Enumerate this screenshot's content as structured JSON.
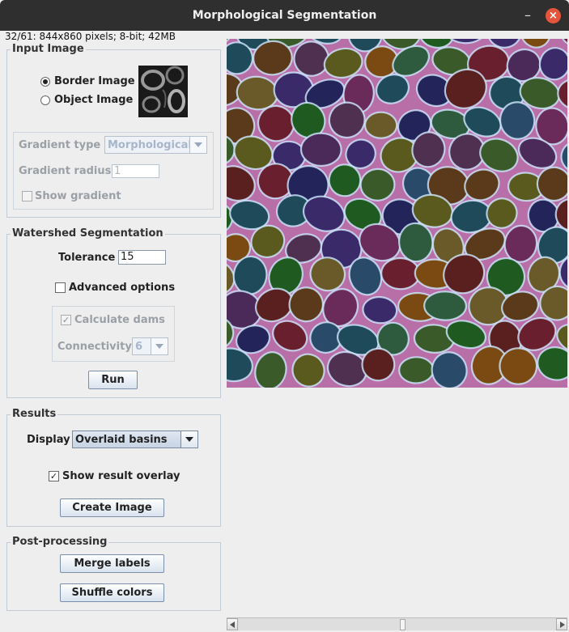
{
  "window": {
    "title": "Morphological Segmentation",
    "status": "32/61: 844x860 pixels; 8-bit; 42MB"
  },
  "input_image": {
    "title": "Input Image",
    "border_image_label": "Border Image",
    "object_image_label": "Object Image",
    "selected": "Border Image",
    "gradient_type_label": "Gradient type",
    "gradient_type_value": "Morphological",
    "gradient_radius_label": "Gradient radius",
    "gradient_radius_value": "1",
    "show_gradient_label": "Show gradient",
    "show_gradient_checked": false
  },
  "watershed": {
    "title": "Watershed Segmentation",
    "tolerance_label": "Tolerance",
    "tolerance_value": "15",
    "advanced_label": "Advanced options",
    "advanced_checked": false,
    "calc_dams_label": "Calculate dams",
    "calc_dams_checked": true,
    "connectivity_label": "Connectivity",
    "connectivity_value": "6",
    "run_label": "Run"
  },
  "results": {
    "title": "Results",
    "display_label": "Display",
    "display_value": "Overlaid basins",
    "show_overlay_label": "Show result overlay",
    "show_overlay_checked": true,
    "create_image_label": "Create Image"
  },
  "post": {
    "title": "Post-processing",
    "merge_label": "Merge labels",
    "shuffle_label": "Shuffle colors"
  },
  "colors": {
    "titlebar": "#2f2f2f",
    "close_button": "#e6553b",
    "panel_border": "#c3cbd6",
    "cell_edge": "#cfe8ff"
  },
  "icons": {
    "minimize": "minimize-icon",
    "close": "close-icon",
    "scroll_left": "arrow-left-icon",
    "scroll_right": "arrow-right-icon"
  }
}
